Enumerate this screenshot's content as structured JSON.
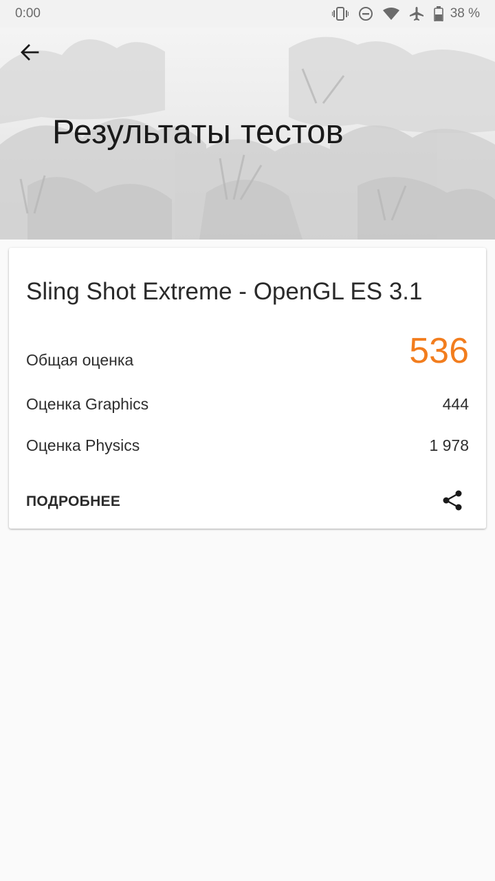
{
  "status_bar": {
    "time": "0:00",
    "icons": [
      "vibrate-icon",
      "do-not-disturb-icon",
      "wifi-icon",
      "airplane-icon",
      "battery-icon"
    ],
    "battery": "38 %"
  },
  "header": {
    "title": "Результаты тестов",
    "back_icon": "arrow-back-icon"
  },
  "card": {
    "test_name": "Sling Shot Extreme - OpenGL ES 3.1",
    "overall": {
      "label": "Общая оценка",
      "value": "536"
    },
    "graphics": {
      "label": "Оценка Graphics",
      "value": "444"
    },
    "physics": {
      "label": "Оценка Physics",
      "value": "1 978"
    },
    "details_label": "ПОДРОБНЕЕ",
    "share_icon": "share-icon"
  },
  "colors": {
    "accent_score": "#f27d1e",
    "background": "#fafafa",
    "card": "#ffffff"
  }
}
